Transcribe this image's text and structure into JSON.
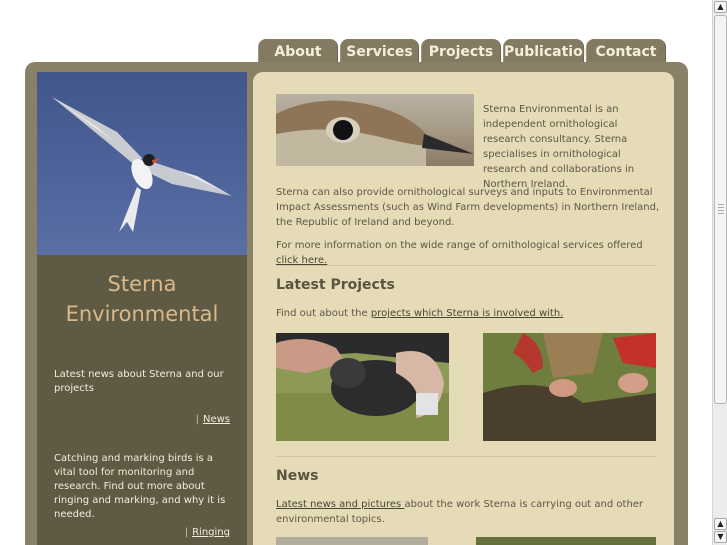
{
  "nav": {
    "tabs": [
      {
        "label": "About"
      },
      {
        "label": "Services"
      },
      {
        "label": "Projects"
      },
      {
        "label": "Publications"
      },
      {
        "label": "Contact Us"
      }
    ]
  },
  "sidebar": {
    "brand_line1": "Sterna",
    "brand_line2": "Environmental",
    "news_blurb": "Latest news about Sterna and our projects",
    "news_link": "News",
    "ringing_blurb": "Catching and marking birds is a vital tool for monitoring and research. Find out more about ringing and marking, and why it is needed.",
    "ringing_link": "Ringing",
    "separator": "|"
  },
  "intro": {
    "para1": "Sterna Environmental is an independent ornithological research consultancy. Sterna specialises in ornithological research and collaborations in Northern Ireland.",
    "para2": "Sterna can also provide ornithological surveys and inputs to Environmental Impact Assessments (such as Wind Farm developments) in Northern Ireland, the Republic of Ireland and beyond.",
    "para3_text": "For more information on the wide range of ornithological services offered ",
    "para3_link": "click here."
  },
  "projects": {
    "heading": "Latest Projects",
    "text": "Find out about the ",
    "link": "projects which Sterna is involved with."
  },
  "news": {
    "heading": "News",
    "link": "Latest news and pictures ",
    "text": "about the work Sterna is carrying out and other environmental topics."
  },
  "scrollbar": {
    "up_arrow": "▲",
    "down_arrow": "▼"
  },
  "colors": {
    "tab_bg": "#847a62",
    "frame": "#8a8068",
    "sidebar_bg": "#5e5a44",
    "content_bg": "#e5dcb7",
    "brand_text": "#d9b98a"
  }
}
